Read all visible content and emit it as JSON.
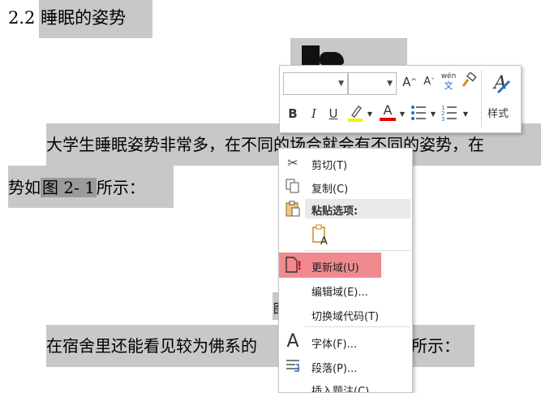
{
  "heading": {
    "text": "2.2 睡眠的姿势"
  },
  "paragraph1": {
    "line1": "大学生睡眠姿势非常多，在不同的场合就会有不同的姿势，在",
    "line2_prefix": "势如",
    "figure_ref": "图 2- 1",
    "line2_suffix": "所示："
  },
  "caption_fragment": "图",
  "paragraph2": {
    "line_prefix": "在宿舍里还能看见较为佛系的",
    "line_suffix": "所示："
  },
  "mini_toolbar": {
    "font_name": "",
    "font_size": "",
    "grow_font": "A",
    "shrink_font": "A",
    "phonetic_top": "wén",
    "phonetic_bottom": "文",
    "bold": "B",
    "italic": "I",
    "underline": "U",
    "font_color_glyph": "A",
    "styles_label": "样式",
    "highlight_color": "#f2f200",
    "font_color": "#e00000",
    "icons": [
      "grow-font-icon",
      "shrink-font-icon",
      "phonetic-guide-icon",
      "format-painter-icon",
      "styles-icon",
      "highlighter-icon",
      "bullets-icon",
      "numbering-icon"
    ]
  },
  "context_menu": {
    "cut": "剪切(T)",
    "copy": "复制(C)",
    "paste_options": "粘贴选项:",
    "update_field": "更新域(U)",
    "edit_field": "编辑域(E)...",
    "toggle_field_codes": "切换域代码(T)",
    "font": "字体(F)...",
    "paragraph": "段落(P)...",
    "insert_caption": "插入题注(C)...",
    "highlight_color": "#f08a8e",
    "icons": [
      "scissors-icon",
      "copy-icon",
      "paste-icon",
      "paste-text-only-icon",
      "update-field-icon",
      "font-icon",
      "paragraph-icon"
    ]
  }
}
